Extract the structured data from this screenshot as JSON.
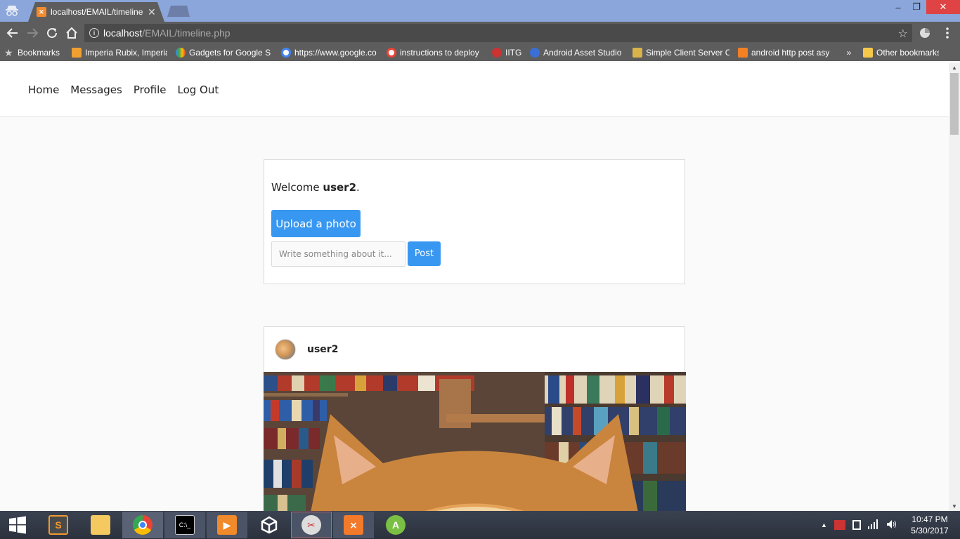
{
  "browser": {
    "tab_title": "localhost/EMAIL/timeline.php",
    "tab_close": "✕",
    "url_host": "localhost",
    "url_path": "/EMAIL/timeline.php"
  },
  "window_controls": {
    "minimize": "–",
    "maximize": "❐",
    "close": "✕"
  },
  "bookmarks": {
    "items": [
      {
        "label": "Bookmarks",
        "icon": "star-icon"
      },
      {
        "label": "Imperia Rubix, Imperia",
        "icon": "imperia-icon"
      },
      {
        "label": "Gadgets for Google S",
        "icon": "gadgets-icon"
      },
      {
        "label": "https://www.google.co",
        "icon": "google-icon"
      },
      {
        "label": "instructions to deploy",
        "icon": "google-icon"
      },
      {
        "label": "IITG",
        "icon": "iitg-icon"
      },
      {
        "label": "Android Asset Studio",
        "icon": "asset-studio-icon"
      },
      {
        "label": "Simple Client Server C",
        "icon": "server-icon"
      },
      {
        "label": "android http post asy",
        "icon": "stackoverflow-icon"
      }
    ],
    "overflow": "»",
    "other": "Other bookmarks"
  },
  "nav": {
    "home": "Home",
    "messages": "Messages",
    "profile": "Profile",
    "logout": "Log Out"
  },
  "welcome": {
    "prefix": "Welcome ",
    "username": "user2",
    "suffix": ".",
    "upload_label": "Upload a photo",
    "input_placeholder": "Write something about it...",
    "post_label": "Post"
  },
  "post": {
    "username": "user2"
  },
  "taskbar": {
    "apps": [
      "sublime-text",
      "file-explorer",
      "chrome",
      "command-prompt",
      "media-player",
      "unity",
      "snipping-tool",
      "xampp",
      "android-studio"
    ],
    "time": "10:47 PM",
    "date": "5/30/2017"
  },
  "colors": {
    "accent": "#3897f0",
    "chrome_frame": "#5d5d5d",
    "tab_strip": "#8aa6da",
    "close_red": "#e04343"
  }
}
